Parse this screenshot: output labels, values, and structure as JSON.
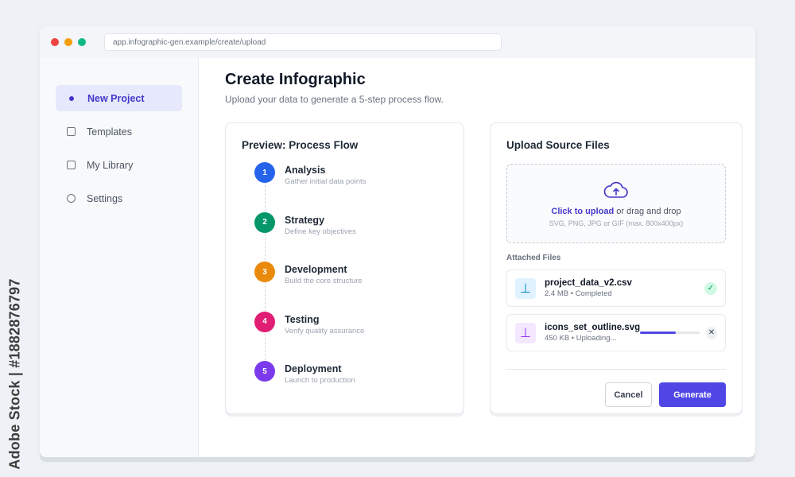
{
  "watermark": "Adobe Stock | #1882876797",
  "browser": {
    "url": "app.infographic-gen.example/create/upload"
  },
  "sidebar": {
    "items": [
      {
        "label": "New Project",
        "icon": "bullet-icon",
        "active": true
      },
      {
        "label": "Templates",
        "icon": "square-icon"
      },
      {
        "label": "My Library",
        "icon": "square-icon"
      },
      {
        "label": "Settings",
        "icon": "circle-icon"
      }
    ]
  },
  "header": {
    "title": "Create Infographic",
    "subtitle": "Upload your data to generate a 5-step process flow."
  },
  "preview": {
    "title": "Preview: Process Flow",
    "steps": [
      {
        "num": "1",
        "title": "Analysis",
        "desc": "Gather initial data points",
        "color": "#2563eb"
      },
      {
        "num": "2",
        "title": "Strategy",
        "desc": "Define key objectives",
        "color": "#059669"
      },
      {
        "num": "3",
        "title": "Development",
        "desc": "Build the core structure",
        "color": "#ea8a0c"
      },
      {
        "num": "4",
        "title": "Testing",
        "desc": "Verify quality assurance",
        "color": "#e11d74"
      },
      {
        "num": "5",
        "title": "Deployment",
        "desc": "Launch to production",
        "color": "#7c3aed"
      }
    ]
  },
  "upload": {
    "title": "Upload Source Files",
    "drop_link": "Click to upload",
    "drop_text": " or drag and drop",
    "drop_hint": "SVG, PNG, JPG or GIF (max. 800x400px)",
    "attached_label": "Attached Files",
    "files": [
      {
        "name": "project_data_v2.csv",
        "meta": "2.4 MB • Completed",
        "status": "completed",
        "icon": "file-upload-icon",
        "accent": "#0284c7"
      },
      {
        "name": "icons_set_outline.svg",
        "meta": "450 KB • Uploading...",
        "status": "uploading",
        "progress": 0.6,
        "icon": "file-upload-icon",
        "accent": "#9333ea"
      }
    ]
  },
  "actions": {
    "cancel_label": "Cancel",
    "generate_label": "Generate"
  },
  "colors": {
    "accent": "#4f46e5",
    "success": "#059669"
  }
}
